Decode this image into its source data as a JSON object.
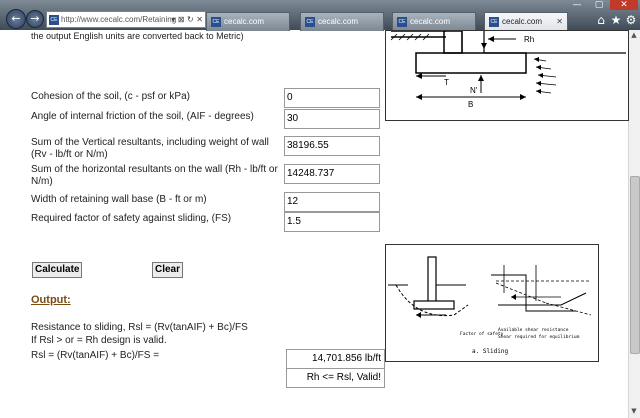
{
  "browser": {
    "address_url": "http://www.cecalc.com/Retaining",
    "favicon_text": "CE",
    "address_controls": "▾ ⊠ ↻ ✕",
    "window_controls": [
      "—",
      "▢",
      "✕"
    ],
    "tabs": [
      {
        "label": "cecalc.com",
        "active": false
      },
      {
        "label": "cecalc.com",
        "active": false
      },
      {
        "label": "cecalc.com",
        "active": false
      },
      {
        "label": "cecalc.com",
        "active": true
      }
    ],
    "tab_close": "✕",
    "back_glyph": "←",
    "forward_glyph": "→",
    "home_glyph": "⌂",
    "favorites_glyph": "★",
    "tools_glyph": "⚙"
  },
  "page": {
    "intro_text": "the output English units are converted back to Metric)",
    "inputs": [
      {
        "label": "Cohesion of the soil, (c - psf or kPa)",
        "value": "0"
      },
      {
        "label": "Angle of internal friction of the soil, (AIF - degrees)",
        "value": "30"
      },
      {
        "label": "Sum of the Vertical resultants, including weight of wall (Rv - lb/ft or N/m)",
        "value": "38196.55"
      },
      {
        "label": "Sum of the horizontal resultants on the wall (Rh - lb/ft or N/m)",
        "value": "14248.737"
      },
      {
        "label": "Width of retaining wall base (B - ft or m)",
        "value": "12"
      },
      {
        "label": "Required factor of safety against sliding, (FS)",
        "value": "1.5"
      }
    ],
    "calculate_label": "Calculate",
    "clear_label": "Clear",
    "output_heading": "Output:",
    "output_lines": [
      "Resistance to sliding, Rsl = (Rv(tanAIF) + Bc)/FS",
      "If Rsl > or = Rh design is valid.",
      "Rsl = (Rv(tanAIF) + Bc)/FS ="
    ],
    "rsl_value": "14,701.856 lb/ft",
    "validity_text": "Rh <= Rsl, Valid!"
  },
  "diagram_top": {
    "labels": [
      "Rh",
      "T",
      "N'",
      "B"
    ]
  },
  "diagram_bottom": {
    "labels": [
      "Factor of safety",
      "Available shear resistance",
      "Shear required for equilibrium",
      "a. Sliding"
    ]
  }
}
